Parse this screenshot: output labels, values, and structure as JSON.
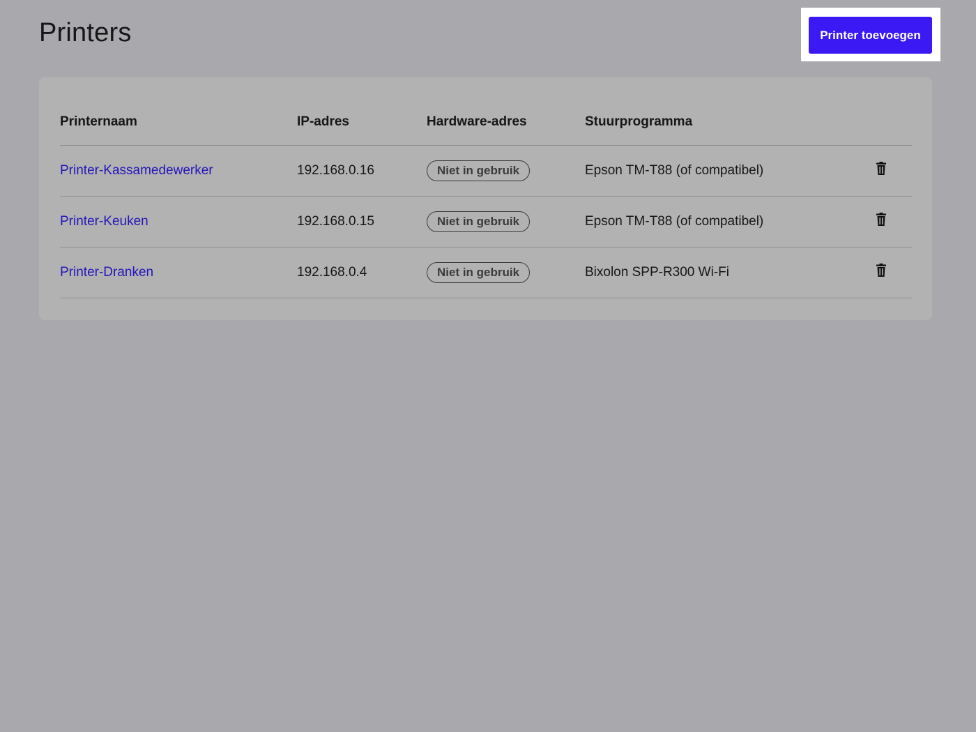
{
  "header": {
    "title": "Printers",
    "add_button_label": "Printer toevoegen"
  },
  "colors": {
    "background": "#a9a8ad",
    "card": "#b2b2b2",
    "accent": "#3a19f5",
    "link": "#2416b8"
  },
  "table": {
    "columns": [
      "Printernaam",
      "IP-adres",
      "Hardware-adres",
      "Stuurprogramma"
    ],
    "rows": [
      {
        "name": "Printer-Kassamedewerker",
        "ip": "192.168.0.16",
        "hardware": "Niet in gebruik",
        "driver": "Epson TM-T88 (of compatibel)",
        "action_icon": "trash-icon"
      },
      {
        "name": "Printer-Keuken",
        "ip": "192.168.0.15",
        "hardware": "Niet in gebruik",
        "driver": "Epson TM-T88 (of compatibel)",
        "action_icon": "trash-icon"
      },
      {
        "name": "Printer-Dranken",
        "ip": "192.168.0.4",
        "hardware": "Niet in gebruik",
        "driver": "Bixolon SPP-R300 Wi-Fi",
        "action_icon": "trash-icon"
      }
    ]
  }
}
